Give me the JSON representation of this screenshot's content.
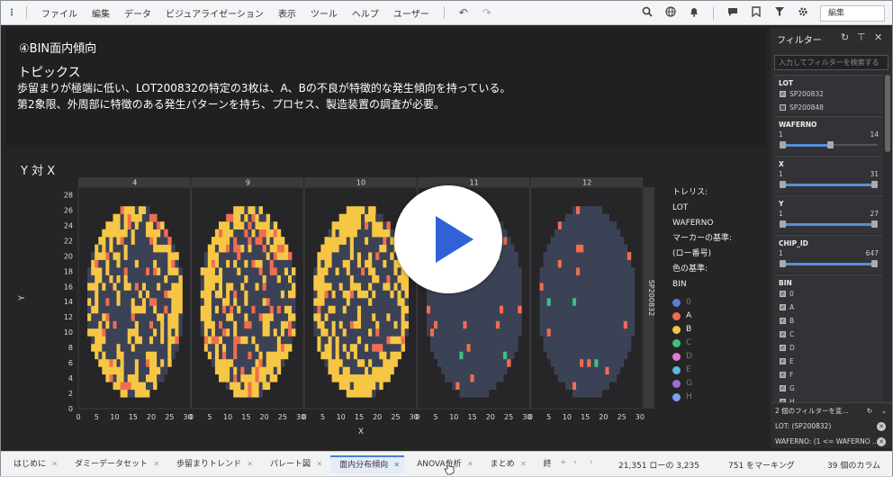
{
  "menubar": {
    "items": [
      "ファイル",
      "編集",
      "データ",
      "ビジュアライゼーション",
      "表示",
      "ツール",
      "ヘルプ",
      "ユーザー"
    ],
    "mode_select": "編集"
  },
  "text_panel": {
    "title": "④BIN面内傾向",
    "topics_heading": "トピックス",
    "line1": "歩留まりが極端に低い、LOT200832の特定の3枚は、A、Bの不良が特徴的な発生傾向を持っている。",
    "line2": "第2象限、外周部に特徴のある発生パターンを持ち、プロセス、製造装置の調査が必要。"
  },
  "viz": {
    "title": "Y 対 X",
    "legend": {
      "trellis_label": "トレリス:",
      "trellis_items": [
        "LOT",
        "WAFERNO"
      ],
      "marker_label": "マーカーの基準:",
      "marker_value": "(ロー番号)",
      "color_label": "色の基準:",
      "color_value": "BIN",
      "bins": [
        {
          "name": "0",
          "color": "#5b7fd6",
          "dim": true
        },
        {
          "name": "A",
          "color": "#f26d4f",
          "dim": false
        },
        {
          "name": "B",
          "color": "#f6c744",
          "dim": false
        },
        {
          "name": "C",
          "color": "#3fbf7f",
          "dim": true
        },
        {
          "name": "D",
          "color": "#e07ad0",
          "dim": true
        },
        {
          "name": "E",
          "color": "#5fb6e0",
          "dim": true
        },
        {
          "name": "G",
          "color": "#9b6fd6",
          "dim": true
        },
        {
          "name": "H",
          "color": "#7b9ff0",
          "dim": true
        }
      ]
    }
  },
  "chart_data": {
    "type": "scatter",
    "title": "Y 対 X",
    "xlabel": "X",
    "ylabel": "Y",
    "panels": [
      "4",
      "9",
      "10",
      "11",
      "12"
    ],
    "row_label": "SP200832",
    "xlim": [
      0,
      31
    ],
    "ylim": [
      0,
      29
    ],
    "x_ticks": [
      "0",
      "5",
      "10",
      "15",
      "20",
      "25",
      "30"
    ],
    "y_ticks": [
      "0",
      "2",
      "4",
      "6",
      "8",
      "10",
      "12",
      "14",
      "16",
      "18",
      "20",
      "22",
      "24",
      "26",
      "28"
    ],
    "series_colors": {
      "0": "#3c4256",
      "A": "#f26d4f",
      "B": "#f6c744",
      "C": "#3fbf7f"
    },
    "panel_yellow_density": [
      0.3,
      0.34,
      0.36,
      0.0,
      0.0
    ],
    "panel_red_density": [
      0.09,
      0.16,
      0.08,
      0.035,
      0.03
    ]
  },
  "filter": {
    "title": "フィルター",
    "search_placeholder": "入力してフィルターを検索する",
    "lot": {
      "label": "LOT",
      "items": [
        {
          "name": "SP200832",
          "checked": true
        },
        {
          "name": "SP200848",
          "checked": false
        }
      ]
    },
    "waferno": {
      "label": "WAFERNO",
      "min": "1",
      "max": "14",
      "lo": 0.0,
      "hi": 0.55
    },
    "x": {
      "label": "X",
      "min": "1",
      "max": "31",
      "lo": 0.0,
      "hi": 1.0
    },
    "y": {
      "label": "Y",
      "min": "1",
      "max": "27",
      "lo": 0.0,
      "hi": 1.0
    },
    "chip": {
      "label": "CHIP_ID",
      "min": "1",
      "max": "647",
      "lo": 0.0,
      "hi": 1.0
    },
    "bin": {
      "label": "BIN",
      "items": [
        {
          "name": "0",
          "checked": true
        },
        {
          "name": "A",
          "checked": true
        },
        {
          "name": "B",
          "checked": true
        },
        {
          "name": "C",
          "checked": true
        },
        {
          "name": "D",
          "checked": true
        },
        {
          "name": "E",
          "checked": true
        },
        {
          "name": "F",
          "checked": true
        },
        {
          "name": "G",
          "checked": true
        },
        {
          "name": "H",
          "checked": true
        }
      ]
    },
    "footer": {
      "summary": "2 個のフィルターを変...",
      "chip1": "LOT: (SP200832)",
      "chip2": "WAFERNO: (1 <= WAFERNO ..."
    }
  },
  "tabs": [
    {
      "label": "はじめに",
      "active": false
    },
    {
      "label": "ダミーデータセット",
      "active": false
    },
    {
      "label": "歩留まりトレンド",
      "active": false
    },
    {
      "label": "パレート図",
      "active": false
    },
    {
      "label": "面内分布傾向",
      "active": true
    },
    {
      "label": "ANOVA分析",
      "active": false
    },
    {
      "label": "まとめ",
      "active": false
    },
    {
      "label": "終",
      "active": false
    }
  ],
  "status": {
    "rows": "21,351 ローの 3,235",
    "marking": "751 をマーキング",
    "columns": "39 個のカラム"
  }
}
